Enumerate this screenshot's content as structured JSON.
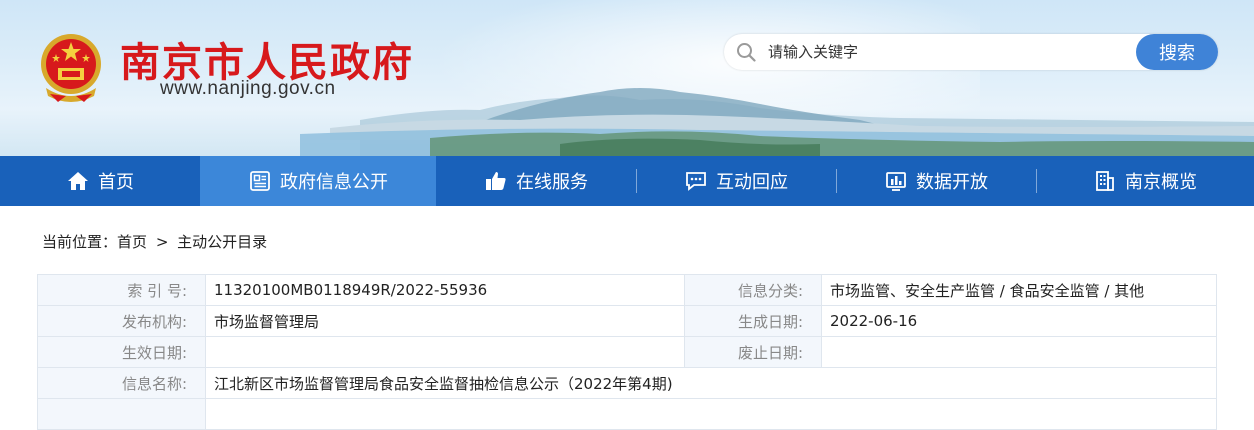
{
  "header": {
    "site_title": "南京市人民政府",
    "site_url": "www.nanjing.gov.cn",
    "search": {
      "placeholder": "请输入关键字",
      "button_label": "搜索"
    }
  },
  "nav": {
    "items": [
      {
        "label": "首页",
        "icon": "home-icon"
      },
      {
        "label": "政府信息公开",
        "icon": "document-icon"
      },
      {
        "label": "在线服务",
        "icon": "thumbs-up-icon"
      },
      {
        "label": "互动回应",
        "icon": "chat-icon"
      },
      {
        "label": "数据开放",
        "icon": "chart-icon"
      },
      {
        "label": "南京概览",
        "icon": "building-icon"
      }
    ],
    "active_index": 1
  },
  "breadcrumb": {
    "prefix": "当前位置：",
    "home": "首页",
    "separator": ">",
    "current": "主动公开目录"
  },
  "info": {
    "index_no_label": "索 引 号:",
    "index_no": "11320100MB0118949R/2022-55936",
    "category_label": "信息分类:",
    "category": "市场监管、安全生产监管 / 食品安全监管 / 其他",
    "publisher_label": "发布机构:",
    "publisher": "市场监督管理局",
    "created_label": "生成日期:",
    "created": "2022-06-16",
    "effective_label": "生效日期:",
    "effective": "",
    "expire_label": "废止日期:",
    "expire": "",
    "name_label": "信息名称:",
    "name": "江北新区市场监督管理局食品安全监督抽检信息公示（2022年第4期)"
  },
  "colors": {
    "brand_red": "#d7191c",
    "nav_blue": "#1961ba",
    "nav_active": "#3c87d9",
    "search_button": "#3f83d7"
  }
}
